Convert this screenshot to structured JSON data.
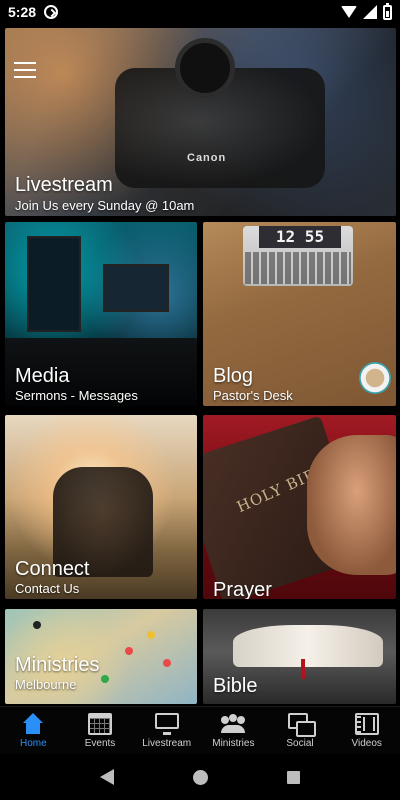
{
  "status_bar": {
    "time": "5:28"
  },
  "tiles": {
    "livestream": {
      "title": "Livestream",
      "subtitle": "Join Us every Sunday @ 10am",
      "camera_brand": "Canon"
    },
    "media": {
      "title": "Media",
      "subtitle": "Sermons - Messages"
    },
    "blog": {
      "title": "Blog",
      "subtitle": "Pastor's Desk",
      "clock_text": "12 55"
    },
    "connect": {
      "title": "Connect",
      "subtitle": "Contact Us"
    },
    "prayer": {
      "title": "Prayer",
      "book_text": "HOLY BIBLE"
    },
    "ministries": {
      "title": "Ministries",
      "subtitle": "Melbourne"
    },
    "bible": {
      "title": "Bible"
    }
  },
  "bottom_nav": {
    "active": "Home",
    "items": [
      {
        "label": "Home",
        "icon": "home-icon"
      },
      {
        "label": "Events",
        "icon": "calendar-icon"
      },
      {
        "label": "Livestream",
        "icon": "tv-icon"
      },
      {
        "label": "Ministries",
        "icon": "group-icon"
      },
      {
        "label": "Social",
        "icon": "chat-icon"
      },
      {
        "label": "Videos",
        "icon": "film-icon"
      }
    ]
  },
  "colors": {
    "accent": "#2a8ff7",
    "background": "#000000"
  }
}
